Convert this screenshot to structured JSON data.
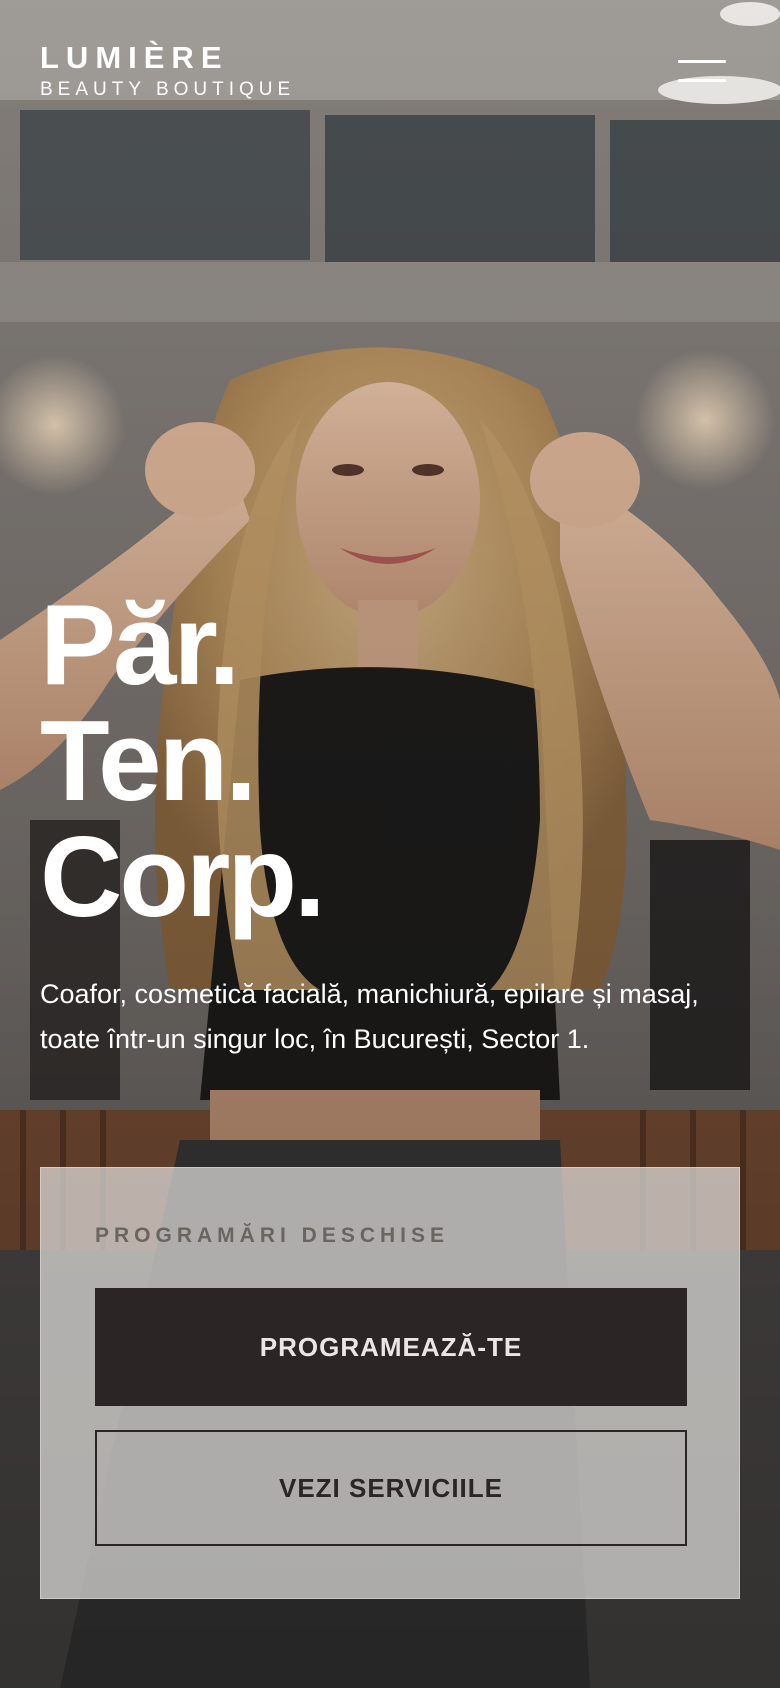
{
  "header": {
    "brand_name": "LUMIÈRE",
    "brand_tagline": "BEAUTY BOUTIQUE",
    "menu_icon": "hamburger-menu-icon"
  },
  "hero": {
    "headline": [
      "Păr.",
      "Ten.",
      "Corp."
    ],
    "subtitle": "Coafor, cosmetică facială, manichiură, epilare și masaj, toate într-un singur loc, în București, Sector 1."
  },
  "booking": {
    "label": "PROGRAMĂRI DESCHISE",
    "primary_button": "PROGRAMEAZĂ-TE",
    "secondary_button": "VEZI SERVICIILE"
  },
  "colors": {
    "text_light": "#ffffff",
    "button_dark": "#2b2625",
    "card_bg": "#e1dfdc"
  }
}
